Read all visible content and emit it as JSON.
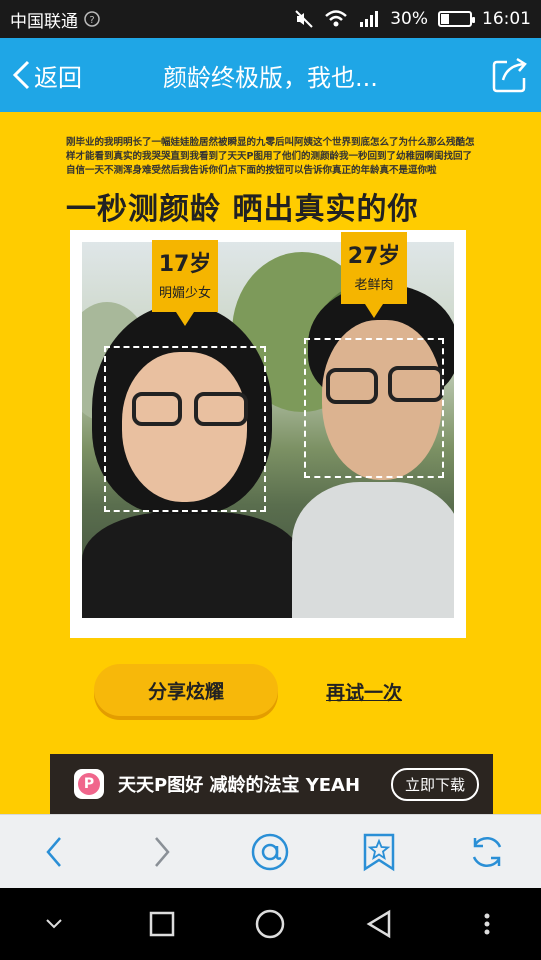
{
  "status_bar": {
    "carrier": "中国联通",
    "battery_text": "30%",
    "battery_level": 0.3,
    "time": "16:01"
  },
  "header": {
    "back_label": "返回",
    "title": "颜龄终极版，我也..."
  },
  "content": {
    "intro_text": "刚毕业的我明明长了一幅娃娃脸居然被瞬显的九零后叫阿姨这个世界到底怎么了为什么那么残酷怎样才能看到真实的我哭哭直到我看到了天天P图用了他们的测颜龄我一秒回到了幼稚园啊闺找回了自信一天不测浑身难受然后我告诉你们点下面的按钮可以告诉你真正的年龄真不是逗你啦",
    "headline": "一秒测颜龄  晒出真实的你",
    "tags": [
      {
        "age": "17岁",
        "label": "明媚少女"
      },
      {
        "age": "27岁",
        "label": "老鲜肉"
      }
    ],
    "share_button": "分享炫耀",
    "retry_link": "再试一次"
  },
  "banner": {
    "logo_letter": "P",
    "text": "天天P图好 减龄的法宝 YEAH",
    "download_label": "立即下载"
  },
  "colors": {
    "header_blue": "#1fa6e6",
    "page_yellow": "#ffcc00",
    "tag_orange": "#f5b500",
    "toolbar_icon_blue": "#2a8fd6"
  },
  "icons": {
    "toolbar": [
      "back-arrow-icon",
      "forward-arrow-icon",
      "home-icon",
      "bookmark-star-icon",
      "refresh-icon"
    ],
    "nav": [
      "chevron-down-icon",
      "square-icon",
      "circle-icon",
      "triangle-back-icon",
      "more-dots-icon"
    ]
  }
}
